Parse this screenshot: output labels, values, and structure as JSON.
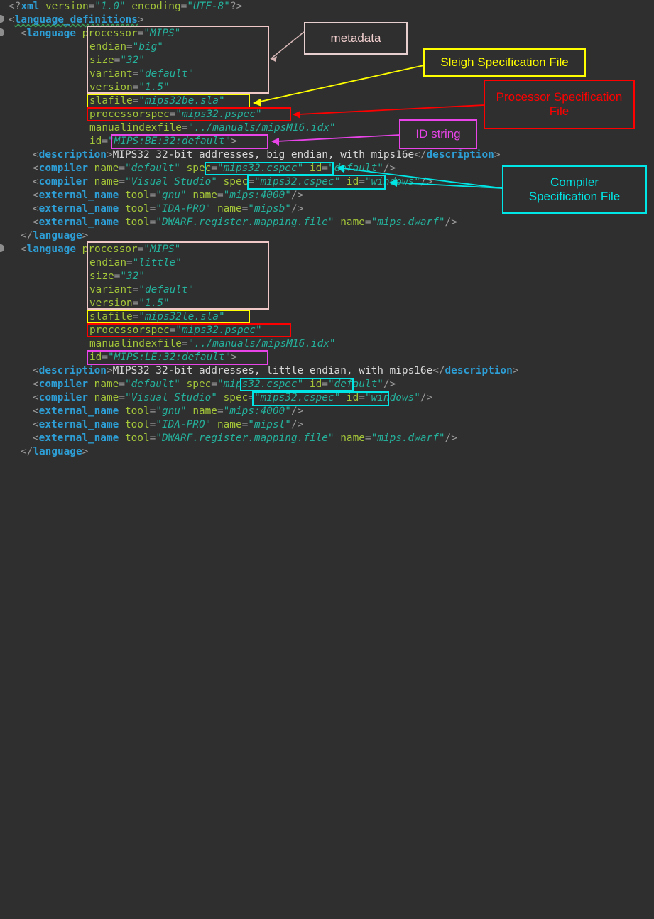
{
  "editor": {
    "background": "#2f2f2f",
    "colors": {
      "tag": "#2d9fd6",
      "attribute": "#a4c639",
      "value": "#25b09b",
      "text": "#d7d7d7",
      "punctuation": "#9a9a9a"
    },
    "lines": [
      {
        "indent": 0,
        "text": "<?xml version=\"1.0\" encoding=\"UTF-8\"?>"
      },
      {
        "indent": 0,
        "text": "<language_definitions>"
      },
      {
        "indent": 2,
        "text": "<language processor=\"MIPS\""
      },
      {
        "indent": 12,
        "text": "endian=\"big\""
      },
      {
        "indent": 12,
        "text": "size=\"32\""
      },
      {
        "indent": 12,
        "text": "variant=\"default\""
      },
      {
        "indent": 12,
        "text": "version=\"1.5\""
      },
      {
        "indent": 12,
        "text": "slafile=\"mips32be.sla\""
      },
      {
        "indent": 12,
        "text": "processorspec=\"mips32.pspec\""
      },
      {
        "indent": 12,
        "text": "manualindexfile=\"../manuals/mipsM16.idx\""
      },
      {
        "indent": 12,
        "text": "id=\"MIPS:BE:32:default\">"
      },
      {
        "indent": 4,
        "text": "<description>MIPS32 32-bit addresses, big endian, with mips16e</description>"
      },
      {
        "indent": 4,
        "text": "<compiler name=\"default\" spec=\"mips32.cspec\" id=\"default\"/>"
      },
      {
        "indent": 4,
        "text": "<compiler name=\"Visual Studio\" spec=\"mips32.cspec\" id=\"windows\"/>"
      },
      {
        "indent": 4,
        "text": "<external_name tool=\"gnu\" name=\"mips:4000\"/>"
      },
      {
        "indent": 4,
        "text": "<external_name tool=\"IDA-PRO\" name=\"mipsb\"/>"
      },
      {
        "indent": 4,
        "text": "<external_name tool=\"DWARF.register.mapping.file\" name=\"mips.dwarf\"/>"
      },
      {
        "indent": 2,
        "text": "</language>"
      },
      {
        "indent": 2,
        "text": "<language processor=\"MIPS\""
      },
      {
        "indent": 12,
        "text": "endian=\"little\""
      },
      {
        "indent": 12,
        "text": "size=\"32\""
      },
      {
        "indent": 12,
        "text": "variant=\"default\""
      },
      {
        "indent": 12,
        "text": "version=\"1.5\""
      },
      {
        "indent": 12,
        "text": "slafile=\"mips32le.sla\""
      },
      {
        "indent": 12,
        "text": "processorspec=\"mips32.pspec\""
      },
      {
        "indent": 12,
        "text": "manualindexfile=\"../manuals/mipsM16.idx\""
      },
      {
        "indent": 12,
        "text": "id=\"MIPS:LE:32:default\">"
      },
      {
        "indent": 4,
        "text": "<description>MIPS32 32-bit addresses, little endian, with mips16e</description>"
      },
      {
        "indent": 4,
        "text": "<compiler name=\"default\" spec=\"mips32.cspec\" id=\"default\"/>"
      },
      {
        "indent": 4,
        "text": "<compiler name=\"Visual Studio\" spec=\"mips32.cspec\" id=\"windows\"/>"
      },
      {
        "indent": 4,
        "text": "<external_name tool=\"gnu\" name=\"mips:4000\"/>"
      },
      {
        "indent": 4,
        "text": "<external_name tool=\"IDA-PRO\" name=\"mipsl\"/>"
      },
      {
        "indent": 4,
        "text": "<external_name tool=\"DWARF.register.mapping.file\" name=\"mips.dwarf\"/>"
      },
      {
        "indent": 2,
        "text": "</language>"
      }
    ]
  },
  "code": {
    "l0": {
      "p1": "<?",
      "tag": "xml",
      "sp1": " ",
      "a1": "version",
      "eq1": "=",
      "v1": "\"1.0\"",
      "sp2": " ",
      "a2": "encoding",
      "eq2": "=",
      "v2": "\"UTF-8\"",
      "p2": "?>"
    },
    "l1": {
      "p1": "<",
      "tag": "language_definitions",
      "p2": ">"
    },
    "l2": {
      "p1": "<",
      "tag": "language",
      "sp": " ",
      "attr": "processor",
      "eq": "=",
      "val": "\"MIPS\""
    },
    "l3": {
      "attr": "endian",
      "eq": "=",
      "val": "\"big\""
    },
    "l4": {
      "attr": "size",
      "eq": "=",
      "val": "\"32\""
    },
    "l5": {
      "attr": "variant",
      "eq": "=",
      "val": "\"default\""
    },
    "l6": {
      "attr": "version",
      "eq": "=",
      "val": "\"1.5\""
    },
    "l7": {
      "attr": "slafile",
      "eq": "=",
      "val": "\"mips32be.sla\""
    },
    "l8": {
      "attr": "processorspec",
      "eq": "=",
      "val": "\"mips32.pspec\""
    },
    "l9": {
      "attr": "manualindexfile",
      "eq": "=",
      "val": "\"../manuals/mipsM16.idx\""
    },
    "l10": {
      "attr": "id",
      "eq": "=",
      "val": "\"MIPS:BE:32:default\"",
      "close": ">"
    },
    "l11": {
      "o1": "<",
      "t1": "description",
      "o2": ">",
      "body": "MIPS32 32-bit addresses, big endian, with mips16e",
      "o3": "</",
      "t2": "description",
      "o4": ">"
    },
    "l12": {
      "o1": "<",
      "tag": "compiler",
      "a1": "name",
      "v1": "\"default\"",
      "a2": "spec",
      "v2": "\"mips32.cspec\"",
      "a3": "id",
      "v3": "\"default\"",
      "end": "/>"
    },
    "l13": {
      "o1": "<",
      "tag": "compiler",
      "a1": "name",
      "v1": "\"Visual Studio\"",
      "a2": "spec",
      "v2": "\"mips32.cspec\"",
      "a3": "id",
      "v3": "\"windows\"",
      "end": "/>"
    },
    "l14": {
      "o1": "<",
      "tag": "external_name",
      "a1": "tool",
      "v1": "\"gnu\"",
      "a2": "name",
      "v2": "\"mips:4000\"",
      "end": "/>"
    },
    "l15": {
      "o1": "<",
      "tag": "external_name",
      "a1": "tool",
      "v1": "\"IDA-PRO\"",
      "a2": "name",
      "v2": "\"mipsb\"",
      "end": "/>"
    },
    "l16": {
      "o1": "<",
      "tag": "external_name",
      "a1": "tool",
      "v1": "\"DWARF.register.mapping.file\"",
      "a2": "name",
      "v2": "\"mips.dwarf\"",
      "end": "/>"
    },
    "l17": {
      "o1": "</",
      "tag": "language",
      "o2": ">"
    },
    "l18": {
      "p1": "<",
      "tag": "language",
      "sp": " ",
      "attr": "processor",
      "eq": "=",
      "val": "\"MIPS\""
    },
    "l19": {
      "attr": "endian",
      "eq": "=",
      "val": "\"little\""
    },
    "l20": {
      "attr": "size",
      "eq": "=",
      "val": "\"32\""
    },
    "l21": {
      "attr": "variant",
      "eq": "=",
      "val": "\"default\""
    },
    "l22": {
      "attr": "version",
      "eq": "=",
      "val": "\"1.5\""
    },
    "l23": {
      "attr": "slafile",
      "eq": "=",
      "val": "\"mips32le.sla\""
    },
    "l24": {
      "attr": "processorspec",
      "eq": "=",
      "val": "\"mips32.pspec\""
    },
    "l25": {
      "attr": "manualindexfile",
      "eq": "=",
      "val": "\"../manuals/mipsM16.idx\""
    },
    "l26": {
      "attr": "id",
      "eq": "=",
      "val": "\"MIPS:LE:32:default\"",
      "close": ">"
    },
    "l27": {
      "o1": "<",
      "t1": "description",
      "o2": ">",
      "body": "MIPS32 32-bit addresses, little endian, with mips16e",
      "o3": "</",
      "t2": "description",
      "o4": ">"
    },
    "l28": {
      "o1": "<",
      "tag": "compiler",
      "a1": "name",
      "v1": "\"default\"",
      "a2": "spec",
      "v2": "\"mips32.cspec\"",
      "a3": "id",
      "v3": "\"default\"",
      "end": "/>"
    },
    "l29": {
      "o1": "<",
      "tag": "compiler",
      "a1": "name",
      "v1": "\"Visual Studio\"",
      "a2": "spec",
      "v2": "\"mips32.cspec\"",
      "a3": "id",
      "v3": "\"windows\"",
      "end": "/>"
    },
    "l30": {
      "o1": "<",
      "tag": "external_name",
      "a1": "tool",
      "v1": "\"gnu\"",
      "a2": "name",
      "v2": "\"mips:4000\"",
      "end": "/>"
    },
    "l31": {
      "o1": "<",
      "tag": "external_name",
      "a1": "tool",
      "v1": "\"IDA-PRO\"",
      "a2": "name",
      "v2": "\"mipsl\"",
      "end": "/>"
    },
    "l32": {
      "o1": "<",
      "tag": "external_name",
      "a1": "tool",
      "v1": "\"DWARF.register.mapping.file\"",
      "a2": "name",
      "v2": "\"mips.dwarf\"",
      "end": "/>"
    },
    "l33": {
      "o1": "</",
      "tag": "language",
      "o2": ">"
    }
  },
  "annotations": [
    {
      "id": "metadata",
      "label": "metadata",
      "color": "#f0c8c8"
    },
    {
      "id": "sleigh",
      "label": "Sleigh Specification File",
      "color": "#ffff00"
    },
    {
      "id": "pspec",
      "label": "Processor Specification File",
      "color": "#ff0000"
    },
    {
      "id": "idstring",
      "label": "ID string",
      "color": "#e844e8"
    },
    {
      "id": "cspec",
      "label": "Compiler Specification File",
      "color": "#00e5e5"
    }
  ],
  "labels": {
    "metadata": "metadata",
    "sleigh": "Sleigh Specification File",
    "pspec_line1": "Processor Specification",
    "pspec_line2": "File",
    "idstring": "ID string",
    "cspec_line1": "Compiler",
    "cspec_line2": "Specification File"
  }
}
